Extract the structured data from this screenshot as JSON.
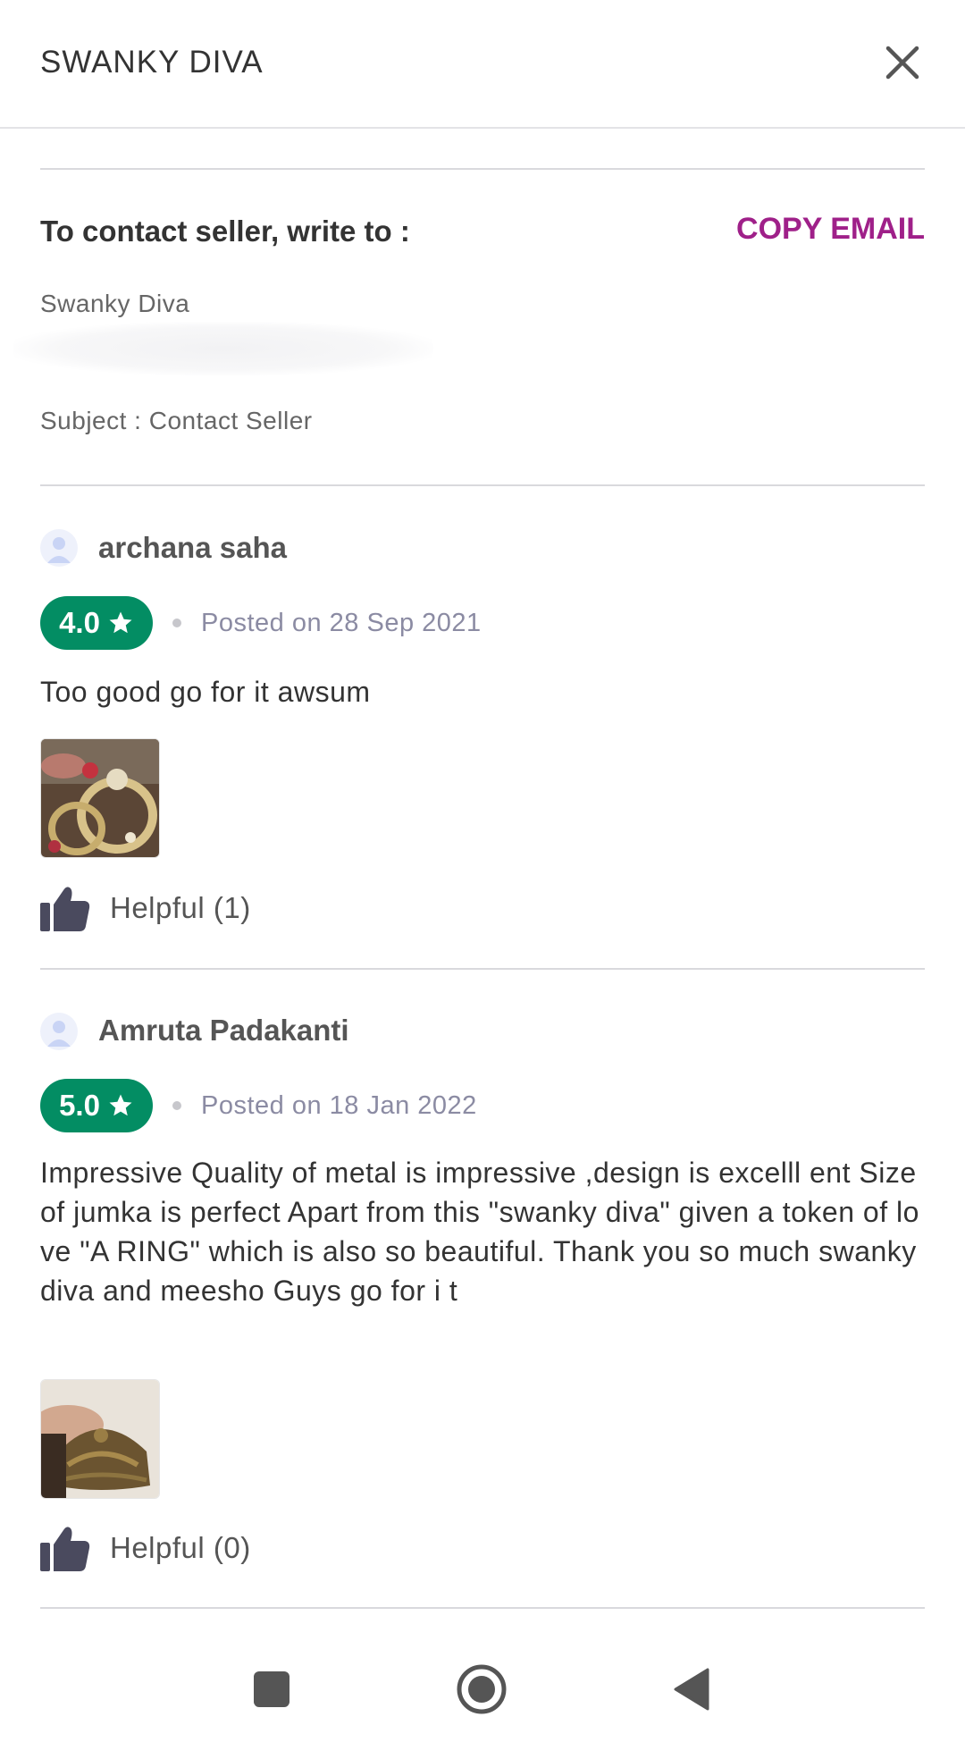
{
  "header": {
    "title": "SWANKY DIVA"
  },
  "contact": {
    "label": "To contact seller, write to :",
    "copy_email_label": "COPY EMAIL",
    "seller_name": "Swanky Diva",
    "subject": "Subject : Contact Seller"
  },
  "reviews": [
    {
      "name": "archana saha",
      "rating": "4.0",
      "posted": "Posted on 28 Sep 2021",
      "text": "Too good go for it awsum",
      "helpful": "Helpful (1)"
    },
    {
      "name": "Amruta Padakanti",
      "rating": "5.0",
      "posted": "Posted on 18 Jan 2022",
      "text": "Impressive Quality of metal is impressive ,design is excelll ent Size of jumka is perfect Apart from this \"swanky diva\" given a token of love \"A RING\" which is also so beautiful. Thank you so much swanky diva and meesho Guys go for i t",
      "helpful": "Helpful (0)"
    }
  ],
  "colors": {
    "accent": "#9f2089",
    "rating_green": "#038d63"
  },
  "icons": [
    "close-icon",
    "star-icon",
    "thumbs-up-icon",
    "user-icon",
    "nav-recents-icon",
    "nav-home-icon",
    "nav-back-icon"
  ]
}
